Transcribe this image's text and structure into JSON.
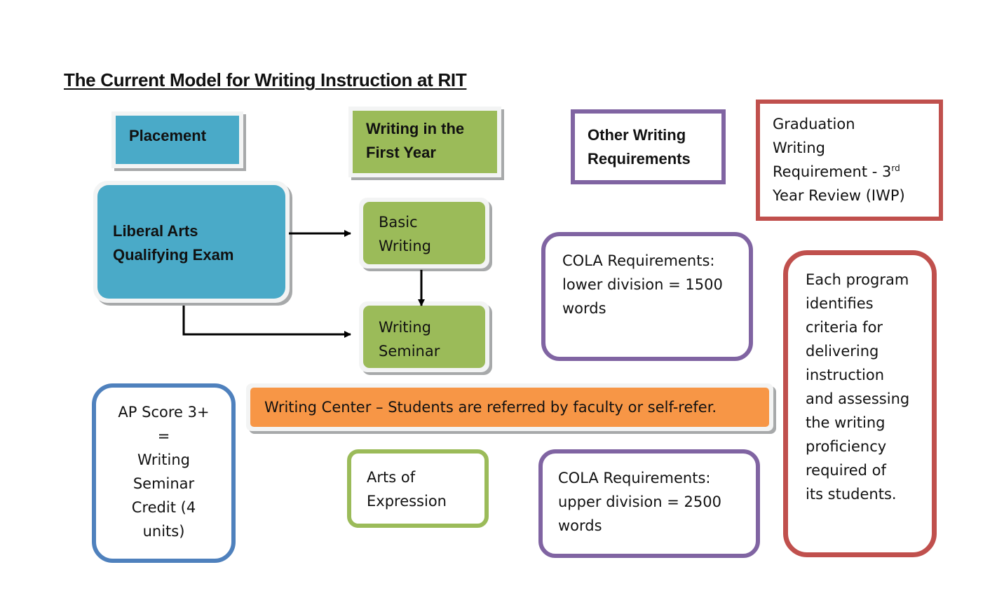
{
  "title": "The Current Model for Writing Instruction at RIT",
  "colors": {
    "blue": "#4aaac8",
    "green": "#9bbb59",
    "orange": "#f79646",
    "purple": "#8064a2",
    "red": "#c0504d",
    "ap_blue": "#4f81bd"
  },
  "headers": {
    "placement": "Placement",
    "first_year": "Writing in the\nFirst Year",
    "other_requirements": "Other Writing\nRequirements",
    "graduation_main": "Graduation\nWriting\nRequirement - 3",
    "graduation_sup": "rd",
    "graduation_tail": "Year Review (IWP)"
  },
  "nodes": {
    "qualifying_exam": "Liberal Arts\nQualifying Exam",
    "basic_writing": "Basic\nWriting",
    "writing_seminar": "Writing\nSeminar",
    "cola_lower": "COLA Requirements:\nlower division = 1500\nwords",
    "program_criteria": "Each program\nidentifies\ncriteria for\ndelivering\ninstruction\nand assessing\nthe writing\nproficiency\nrequired of\nits students.",
    "writing_center": "Writing Center – Students are referred by faculty or self-refer.",
    "ap_score": "AP Score 3+\n=\nWriting\nSeminar\nCredit (4\nunits)",
    "arts_of_expression": "Arts of\nExpression",
    "cola_upper": "COLA Requirements:\nupper division = 2500\nwords"
  },
  "edges": [
    {
      "from": "qualifying_exam",
      "to": "basic_writing"
    },
    {
      "from": "qualifying_exam",
      "to": "writing_seminar"
    },
    {
      "from": "basic_writing",
      "to": "writing_seminar"
    }
  ]
}
